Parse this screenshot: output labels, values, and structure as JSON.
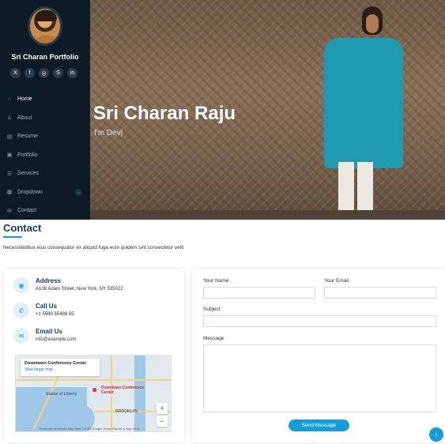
{
  "sidebar": {
    "site_title": "Sri Charan Portfolio",
    "socials": [
      {
        "icon": "x-twitter-icon",
        "glyph": "X"
      },
      {
        "icon": "facebook-icon",
        "glyph": "f"
      },
      {
        "icon": "instagram-icon",
        "glyph": "◎"
      },
      {
        "icon": "skype-icon",
        "glyph": "S"
      },
      {
        "icon": "linkedin-icon",
        "glyph": "in"
      }
    ],
    "nav": [
      {
        "label": "Home",
        "icon": "home-icon",
        "glyph": "⌂",
        "active": true
      },
      {
        "label": "About",
        "icon": "person-icon",
        "glyph": "♙",
        "active": false
      },
      {
        "label": "Resume",
        "icon": "file-icon",
        "glyph": "▤",
        "active": false
      },
      {
        "label": "Portfolio",
        "icon": "images-icon",
        "glyph": "▣",
        "active": false
      },
      {
        "label": "Services",
        "icon": "hdd-stack-icon",
        "glyph": "☰",
        "active": false
      },
      {
        "label": "Dropdown",
        "icon": "menu-icon",
        "glyph": "▦",
        "active": false
      },
      {
        "label": "Contact",
        "icon": "envelope-icon",
        "glyph": "✉",
        "active": false
      }
    ],
    "dropdown_chevron": "⌄"
  },
  "hero": {
    "name": "Sri Charan Raju",
    "subtitle": "I'm Dev|"
  },
  "contact": {
    "title": "Contact",
    "description": "Necessitatibus eius consequatur ex aliquid fuga eum quidem sint consectetur velit",
    "info": {
      "address_title": "Address",
      "address_text": "A108 Adam Street, New York, NY 535022",
      "call_title": "Call Us",
      "call_text": "+1 5589 55488 55",
      "email_title": "Email Us",
      "email_text": "info@example.com"
    },
    "map": {
      "card_title": "Downtown Conference Center",
      "card_link": "View larger map",
      "pin_label": "Downtown Conference Center",
      "labels": [
        "Statue of Liberty",
        "BROOKLYN"
      ],
      "zoom_in": "+",
      "zoom_out": "−",
      "footer": "Keyboard shortcuts   Map data ©2025 Google   Terms   Report a map error"
    },
    "form": {
      "name_label": "Your Name",
      "email_label": "Your Email",
      "subject_label": "Subject",
      "message_label": "Message",
      "send_label": "Send Message"
    }
  },
  "back_to_top_glyph": "↑",
  "colors": {
    "accent": "#149ddd",
    "sidebar_bg": "#0d1b26",
    "heading": "#173b6c"
  }
}
